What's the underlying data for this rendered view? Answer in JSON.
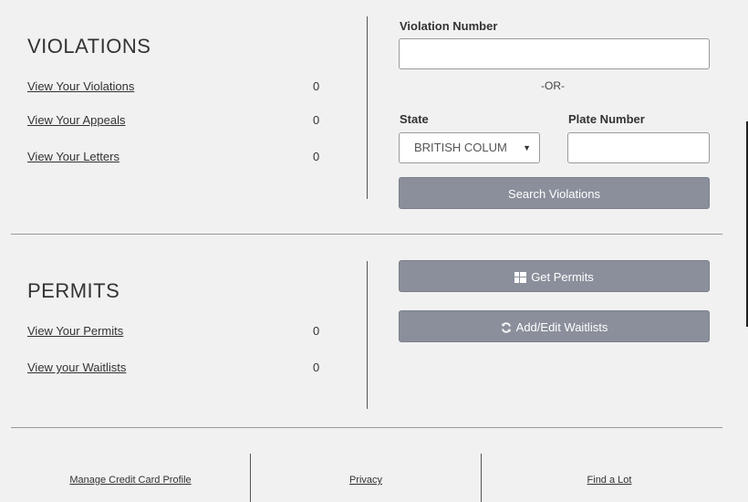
{
  "violations": {
    "title": "VIOLATIONS",
    "links": [
      {
        "label": "View Your Violations",
        "count": "0"
      },
      {
        "label": "View Your Appeals",
        "count": "0"
      },
      {
        "label": "View Your Letters",
        "count": "0"
      }
    ]
  },
  "search": {
    "violation_label": "Violation Number",
    "violation_value": "",
    "or_text": "-OR-",
    "state_label": "State",
    "state_value": "BRITISH COLUM",
    "plate_label": "Plate Number",
    "plate_value": "",
    "search_button": "Search Violations"
  },
  "permits": {
    "title": "PERMITS",
    "links": [
      {
        "label": "View Your Permits",
        "count": "0"
      },
      {
        "label": "View your Waitlists",
        "count": "0"
      }
    ],
    "get_permits_button": "Get Permits",
    "waitlists_button": "Add/Edit Waitlists",
    "get_permits_icon": "grid-icon",
    "waitlists_icon": "refresh-icon"
  },
  "footer": {
    "links": [
      "Manage Credit Card Profile",
      "Privacy",
      "Find a Lot"
    ]
  }
}
